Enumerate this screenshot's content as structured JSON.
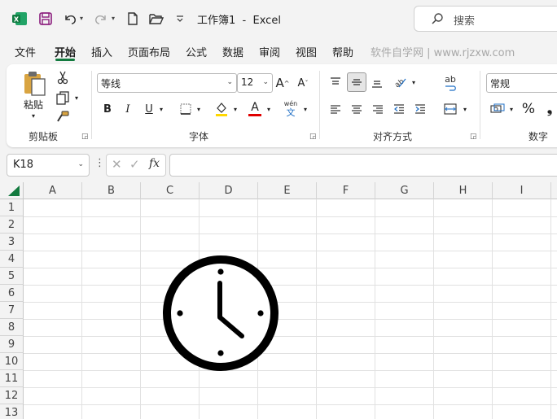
{
  "app": {
    "title": "工作簿1  -  Excel",
    "search_placeholder": "搜索",
    "accent_color": "#137a3f"
  },
  "menu": {
    "items": [
      "文件",
      "开始",
      "插入",
      "页面布局",
      "公式",
      "数据",
      "审阅",
      "视图",
      "帮助"
    ],
    "active": "开始",
    "watermark": "软件自学网 | www.rjzxw.com"
  },
  "ribbon": {
    "clipboard": {
      "paste_label": "粘贴",
      "group_label": "剪贴板"
    },
    "font": {
      "font_name": "等线",
      "font_size": "12",
      "group_label": "字体",
      "bold": "B",
      "italic": "I",
      "underline": "U",
      "font_color_letter": "A",
      "phonetic_top": "wén",
      "phonetic_bottom": "文",
      "grow_font": "A",
      "shrink_font": "A"
    },
    "alignment": {
      "group_label": "对齐方式",
      "wrap_text_label": "ab"
    },
    "number": {
      "format": "常规",
      "group_label": "数字",
      "percent": "%"
    }
  },
  "formula_bar": {
    "name_box": "K18",
    "fx_label": "fx",
    "formula": ""
  },
  "sheet": {
    "columns": [
      "A",
      "B",
      "C",
      "D",
      "E",
      "F",
      "G",
      "H",
      "I"
    ],
    "rows": [
      "1",
      "2",
      "3",
      "4",
      "5",
      "6",
      "7",
      "8",
      "9",
      "10",
      "11",
      "12",
      "13"
    ],
    "inserted_icon": "clock-icon"
  }
}
